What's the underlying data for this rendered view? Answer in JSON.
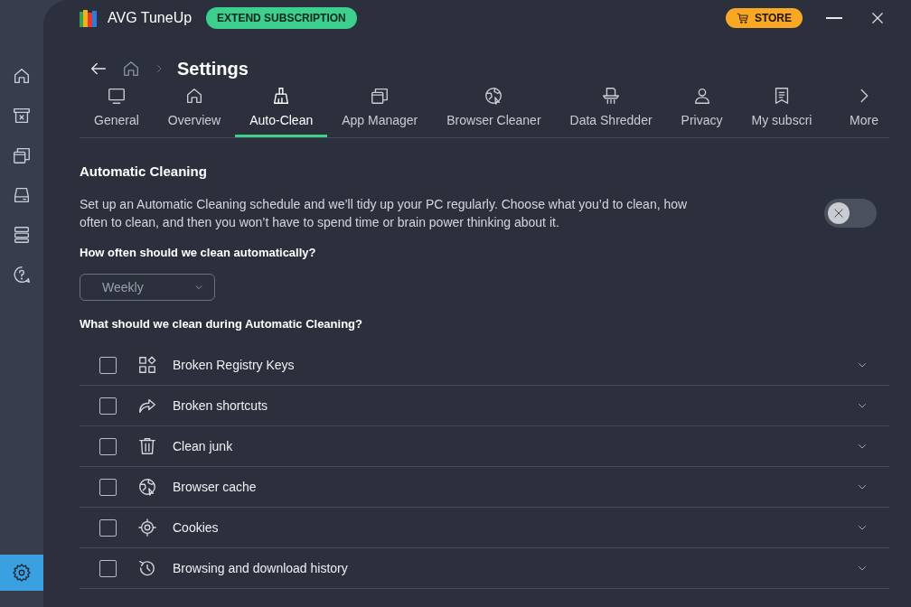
{
  "app": {
    "title": "AVG TuneUp",
    "extend_button": "EXTEND SUBSCRIPTION",
    "store_button": "STORE"
  },
  "sidebar": {
    "items": [
      {
        "selected": false
      },
      {
        "selected": false
      },
      {
        "selected": false
      },
      {
        "selected": false
      },
      {
        "selected": false
      },
      {
        "selected": false
      }
    ],
    "settings": {
      "selected": true
    }
  },
  "breadcrumb": {
    "title": "Settings"
  },
  "tabs": [
    {
      "label": "General",
      "selected": false
    },
    {
      "label": "Overview",
      "selected": false
    },
    {
      "label": "Auto-Clean",
      "selected": true
    },
    {
      "label": "App Manager",
      "selected": false
    },
    {
      "label": "Browser Cleaner",
      "selected": false
    },
    {
      "label": "Data Shredder",
      "selected": false
    },
    {
      "label": "Privacy",
      "selected": false
    },
    {
      "label": "My subscri",
      "selected": false
    }
  ],
  "more_label": "More",
  "section": {
    "heading": "Automatic Cleaning",
    "description": "Set up an Automatic Cleaning schedule and we’ll tidy up your PC regularly. Choose what you’d to clean, how often to clean, and then you won’t have to spend time or brain power thinking about it.",
    "toggle_on": false
  },
  "frequency": {
    "question": "How often should we clean automatically?",
    "value": "Weekly"
  },
  "items_question": "What should we clean during Automatic Cleaning?",
  "items": [
    {
      "label": "Broken Registry Keys",
      "checked": false,
      "expanded": false
    },
    {
      "label": "Broken shortcuts",
      "checked": false,
      "expanded": false
    },
    {
      "label": "Clean junk",
      "checked": false,
      "expanded": false
    },
    {
      "label": "Browser cache",
      "checked": false,
      "expanded": false
    },
    {
      "label": "Cookies",
      "checked": false,
      "expanded": false
    },
    {
      "label": "Browsing and download history",
      "checked": false,
      "expanded": false
    }
  ]
}
